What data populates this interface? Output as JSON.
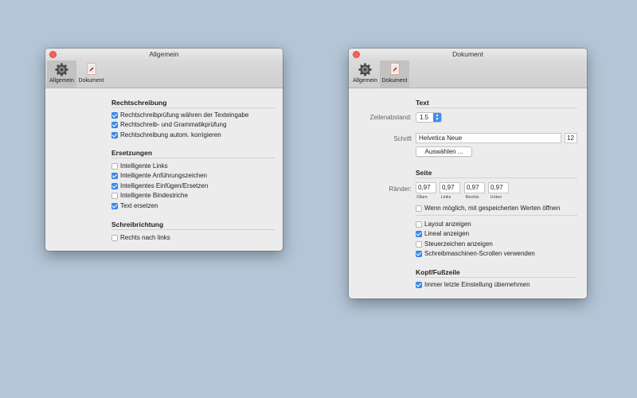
{
  "colors": {
    "desktop": "#b3c5d6",
    "accent": "#3d8ef0",
    "close": "#fc605c"
  },
  "win1": {
    "title": "Allgemein",
    "toolbar": [
      {
        "label": "Allgemein",
        "icon": "gear-icon",
        "selected": true
      },
      {
        "label": "Dokument",
        "icon": "document-icon",
        "selected": false
      }
    ],
    "sections": [
      {
        "title": "Rechtschreibung",
        "items": [
          {
            "label": "Rechtschreibprüfung währen der Texteingabe",
            "checked": true
          },
          {
            "label": "Rechtschreib- und Grammatikprüfung",
            "checked": true
          },
          {
            "label": "Rechtschreibung autom. korrigieren",
            "checked": true
          }
        ]
      },
      {
        "title": "Ersetzungen",
        "items": [
          {
            "label": "Intelligente Links",
            "checked": false
          },
          {
            "label": "Intelligente Anführungszeichen",
            "checked": true
          },
          {
            "label": "Intelligentes Einfügen/Ersetzen",
            "checked": true
          },
          {
            "label": "Intelligente Bindestriche",
            "checked": false
          },
          {
            "label": "Text ersetzen",
            "checked": true
          }
        ]
      },
      {
        "title": "Schreibrichtung",
        "items": [
          {
            "label": "Rechts nach links",
            "checked": false
          }
        ]
      }
    ]
  },
  "win2": {
    "title": "Dokument",
    "toolbar": [
      {
        "label": "Allgemein",
        "icon": "gear-icon",
        "selected": false
      },
      {
        "label": "Dokument",
        "icon": "document-icon",
        "selected": true
      }
    ],
    "text_section": {
      "title": "Text",
      "line_spacing_label": "Zeilenabstand:",
      "line_spacing_value": "1.5",
      "font_label": "Schrift",
      "font_value": "Helvetica Neue",
      "font_size": "12",
      "choose_button": "Auswählen ..."
    },
    "page_section": {
      "title": "Seite",
      "margins_label": "Ränder:",
      "margins": [
        {
          "value": "0,97",
          "label": "Oben"
        },
        {
          "value": "0,97",
          "label": "Links"
        },
        {
          "value": "0,97",
          "label": "Rechts"
        },
        {
          "value": "0,97",
          "label": "Unten"
        }
      ],
      "saved_values": {
        "label": "Wenn möglich, mit gespeicherten Werten öffnen",
        "checked": false
      },
      "options": [
        {
          "label": "Layout anzeigen",
          "checked": false
        },
        {
          "label": "Lineal anzeigen",
          "checked": true
        },
        {
          "label": "Steuerzeichen anzeigen",
          "checked": false
        },
        {
          "label": "Schreibmaschinen-Scrollen verwenden",
          "checked": true
        }
      ]
    },
    "header_section": {
      "title": "Kopf/Fußzeile",
      "option": {
        "label": "Immer letzte Einstellung übernehmen",
        "checked": true
      }
    }
  }
}
